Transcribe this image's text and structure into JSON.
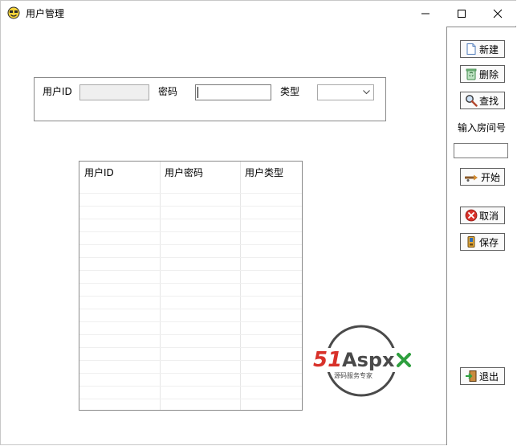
{
  "window": {
    "title": "用户管理"
  },
  "form": {
    "user_id_label": "用户ID",
    "user_id_value": "",
    "password_label": "密码",
    "password_value": "",
    "type_label": "类型",
    "type_selected": ""
  },
  "grid": {
    "columns": [
      "用户ID",
      "用户密码",
      "用户类型"
    ],
    "rows": []
  },
  "sidebar": {
    "new_label": "新建",
    "delete_label": "删除",
    "search_label": "查找",
    "room_label": "输入房间号",
    "room_value": "",
    "start_label": "开始",
    "cancel_label": "取消",
    "save_label": "保存",
    "exit_label": "退出"
  },
  "watermark": {
    "brand": "51Aspx",
    "tagline": "源码服务专家"
  },
  "colors": {
    "accent_red": "#d8312a",
    "accent_green": "#2e9f3e",
    "border": "#8a8a8a"
  },
  "icons": {
    "app": "smiley-app-icon",
    "minimize": "minimize-icon",
    "maximize": "maximize-icon",
    "close": "close-icon",
    "new": "new-document-icon",
    "delete": "recycle-delete-icon",
    "search": "search-magnifier-icon",
    "start": "start-arrow-icon",
    "cancel": "cancel-x-icon",
    "save": "save-disk-icon",
    "exit": "exit-door-icon"
  }
}
